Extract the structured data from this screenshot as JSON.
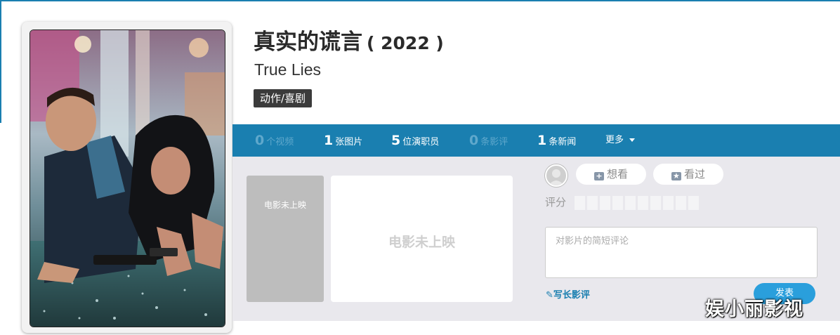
{
  "movie": {
    "title_cn": "真实的谎言",
    "year": "( 2022 )",
    "title_en": "True Lies",
    "genre": "动作/喜剧"
  },
  "stats": [
    {
      "num": "0",
      "label": "个视频"
    },
    {
      "num": "1",
      "label": "张图片"
    },
    {
      "num": "5",
      "label": "位演职员"
    },
    {
      "num": "0",
      "label": "条影评"
    },
    {
      "num": "1",
      "label": "条新闻"
    }
  ],
  "more_label": "更多",
  "tiles": {
    "small": "电影未上映",
    "large": "电影未上映"
  },
  "actions": {
    "want": "想看",
    "seen": "看过",
    "rating_label": "评分",
    "comment_placeholder": "对影片的简短评论",
    "write_long": "写长影评",
    "post": "发表"
  },
  "watermark": "娱小丽影视",
  "colors": {
    "accent_blue": "#1a7fb0",
    "button_blue": "#2a9fdc",
    "content_bg": "#e9e8ed"
  }
}
